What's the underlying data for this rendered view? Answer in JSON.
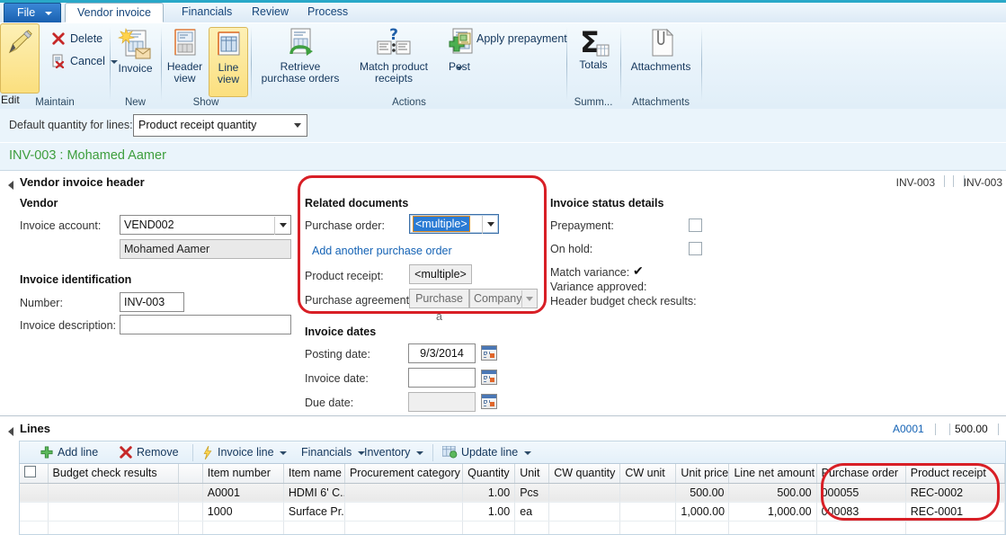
{
  "ribbon": {
    "tabs": [
      {
        "id": "file",
        "label": "File"
      },
      {
        "id": "vendor-invoice",
        "label": "Vendor invoice"
      },
      {
        "id": "financials",
        "label": "Financials"
      },
      {
        "id": "review",
        "label": "Review"
      },
      {
        "id": "process",
        "label": "Process"
      }
    ],
    "groups": [
      {
        "id": "maintain",
        "label": "Maintain"
      },
      {
        "id": "new",
        "label": "New"
      },
      {
        "id": "show",
        "label": "Show"
      },
      {
        "id": "actions",
        "label": "Actions"
      },
      {
        "id": "summ",
        "label": "Summ..."
      },
      {
        "id": "attachments",
        "label": "Attachments"
      }
    ],
    "buttons": {
      "edit": "Edit",
      "delete": "Delete",
      "cancel": "Cancel",
      "invoice": "Invoice",
      "header_view_l1": "Header",
      "header_view_l2": "view",
      "line_view_l1": "Line",
      "line_view_l2": "view",
      "retrieve_l1": "Retrieve",
      "retrieve_l2": "purchase orders",
      "match_l1": "Match product",
      "match_l2": "receipts",
      "post": "Post",
      "apply_prepayment": "Apply prepayment",
      "totals": "Totals",
      "attachments": "Attachments"
    }
  },
  "filterbar": {
    "default_quantity_label": "Default quantity for lines:",
    "default_quantity_value": "Product receipt quantity"
  },
  "record_title": "INV-003 : Mohamed Aamer",
  "header_fasttab": {
    "caption": "Vendor invoice header",
    "right_indicator_1": "INV-003",
    "right_indicator_2": "INV-003",
    "vendor": {
      "section": "Vendor",
      "invoice_account_label": "Invoice account:",
      "invoice_account_value": "VEND002",
      "vendor_name_value": "Mohamed Aamer"
    },
    "invoice_identification": {
      "section": "Invoice identification",
      "number_label": "Number:",
      "number_value": "INV-003",
      "description_label": "Invoice description:",
      "description_value": ""
    },
    "related_documents": {
      "section": "Related documents",
      "purchase_order_label": "Purchase order:",
      "purchase_order_value": "<multiple>",
      "add_another_link": "Add another purchase order",
      "product_receipt_label": "Product receipt:",
      "product_receipt_value": "<multiple>",
      "purchase_agreement_label": "Purchase agreement:",
      "purchase_agreement_value": "Purchase a",
      "purchase_agreement_company": "Company"
    },
    "invoice_dates": {
      "section": "Invoice dates",
      "posting_date_label": "Posting date:",
      "posting_date_value": "9/3/2014",
      "invoice_date_label": "Invoice date:",
      "invoice_date_value": "",
      "due_date_label": "Due date:",
      "due_date_value": ""
    },
    "invoice_status_details": {
      "section": "Invoice status details",
      "prepayment_label": "Prepayment:",
      "prepayment_checked": false,
      "on_hold_label": "On hold:",
      "on_hold_checked": false,
      "match_variance_label": "Match variance:",
      "match_variance_mark": "✔",
      "variance_approved_label": "Variance approved:",
      "header_budget_label": "Header budget check results:"
    }
  },
  "lines_fasttab": {
    "caption": "Lines",
    "right_indicator_1": "A0001",
    "right_indicator_2": "500.00",
    "toolbar": {
      "add_line": "Add line",
      "remove": "Remove",
      "invoice_line": "Invoice line",
      "financials": "Financials",
      "inventory": "Inventory",
      "update_line": "Update line"
    },
    "grid": {
      "columns": [
        "Budget check results",
        "",
        "Item number",
        "Item name",
        "Procurement category",
        "Quantity",
        "Unit",
        "CW quantity",
        "CW unit",
        "Unit price",
        "Line net amount",
        "Purchase order",
        "Product receipt"
      ],
      "rows": [
        {
          "budget_check_results": "",
          "blank": "",
          "item_number": "A0001",
          "item_name": "HDMI 6' C...",
          "procurement_category": "",
          "quantity": "1.00",
          "unit": "Pcs",
          "cw_quantity": "",
          "cw_unit": "",
          "unit_price": "500.00",
          "line_net_amount": "500.00",
          "purchase_order": "000055",
          "product_receipt": "REC-0002"
        },
        {
          "budget_check_results": "",
          "blank": "",
          "item_number": "1000",
          "item_name": "Surface Pr...",
          "procurement_category": "",
          "quantity": "1.00",
          "unit": "ea",
          "cw_quantity": "",
          "cw_unit": "",
          "unit_price": "1,000.00",
          "line_net_amount": "1,000.00",
          "purchase_order": "000083",
          "product_receipt": "REC-0001"
        },
        {
          "budget_check_results": "",
          "blank": "",
          "item_number": "",
          "item_name": "",
          "procurement_category": "",
          "quantity": "",
          "unit": "",
          "cw_quantity": "",
          "cw_unit": "",
          "unit_price": "",
          "line_net_amount": "",
          "purchase_order": "",
          "product_receipt": ""
        }
      ]
    }
  },
  "annotations": {
    "highlight_color": "#d81f26",
    "highlight_1": "related-documents",
    "highlight_2": "purchase-order-and-product-receipt-columns"
  }
}
